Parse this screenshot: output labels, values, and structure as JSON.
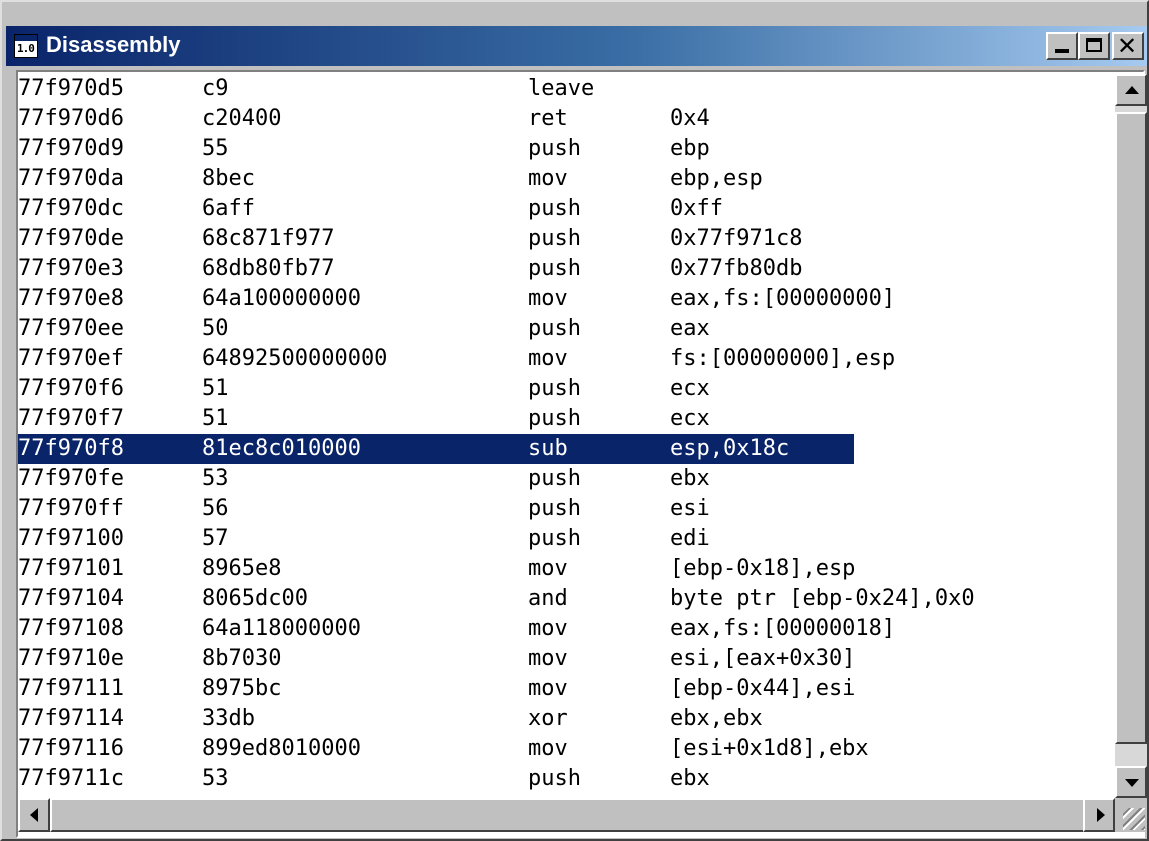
{
  "window": {
    "title": "Disassembly",
    "icon_label": "1.0",
    "controls": [
      "minimize",
      "maximize",
      "close"
    ],
    "close_glyph": "✕"
  },
  "colors": {
    "titlebar": "#0a246a",
    "selection_bg": "#0a246a",
    "selection_fg": "#ffffff"
  },
  "disassembly": {
    "selected_index": 12,
    "lines": [
      {
        "addr": "77f970d5",
        "bytes": "c9",
        "mnemonic": "leave",
        "operands": ""
      },
      {
        "addr": "77f970d6",
        "bytes": "c20400",
        "mnemonic": "ret",
        "operands": "0x4"
      },
      {
        "addr": "77f970d9",
        "bytes": "55",
        "mnemonic": "push",
        "operands": "ebp"
      },
      {
        "addr": "77f970da",
        "bytes": "8bec",
        "mnemonic": "mov",
        "operands": "ebp,esp"
      },
      {
        "addr": "77f970dc",
        "bytes": "6aff",
        "mnemonic": "push",
        "operands": "0xff"
      },
      {
        "addr": "77f970de",
        "bytes": "68c871f977",
        "mnemonic": "push",
        "operands": "0x77f971c8"
      },
      {
        "addr": "77f970e3",
        "bytes": "68db80fb77",
        "mnemonic": "push",
        "operands": "0x77fb80db"
      },
      {
        "addr": "77f970e8",
        "bytes": "64a100000000",
        "mnemonic": "mov",
        "operands": "eax,fs:[00000000]"
      },
      {
        "addr": "77f970ee",
        "bytes": "50",
        "mnemonic": "push",
        "operands": "eax"
      },
      {
        "addr": "77f970ef",
        "bytes": "64892500000000",
        "mnemonic": "mov",
        "operands": "fs:[00000000],esp"
      },
      {
        "addr": "77f970f6",
        "bytes": "51",
        "mnemonic": "push",
        "operands": "ecx"
      },
      {
        "addr": "77f970f7",
        "bytes": "51",
        "mnemonic": "push",
        "operands": "ecx"
      },
      {
        "addr": "77f970f8",
        "bytes": "81ec8c010000",
        "mnemonic": "sub",
        "operands": "esp,0x18c"
      },
      {
        "addr": "77f970fe",
        "bytes": "53",
        "mnemonic": "push",
        "operands": "ebx"
      },
      {
        "addr": "77f970ff",
        "bytes": "56",
        "mnemonic": "push",
        "operands": "esi"
      },
      {
        "addr": "77f97100",
        "bytes": "57",
        "mnemonic": "push",
        "operands": "edi"
      },
      {
        "addr": "77f97101",
        "bytes": "8965e8",
        "mnemonic": "mov",
        "operands": "[ebp-0x18],esp"
      },
      {
        "addr": "77f97104",
        "bytes": "8065dc00",
        "mnemonic": "and",
        "operands": "byte ptr [ebp-0x24],0x0"
      },
      {
        "addr": "77f97108",
        "bytes": "64a118000000",
        "mnemonic": "mov",
        "operands": "eax,fs:[00000018]"
      },
      {
        "addr": "77f9710e",
        "bytes": "8b7030",
        "mnemonic": "mov",
        "operands": "esi,[eax+0x30]"
      },
      {
        "addr": "77f97111",
        "bytes": "8975bc",
        "mnemonic": "mov",
        "operands": "[ebp-0x44],esi"
      },
      {
        "addr": "77f97114",
        "bytes": "33db",
        "mnemonic": "xor",
        "operands": "ebx,ebx"
      },
      {
        "addr": "77f97116",
        "bytes": "899ed8010000",
        "mnemonic": "mov",
        "operands": "[esi+0x1d8],ebx"
      },
      {
        "addr": "77f9711c",
        "bytes": "53",
        "mnemonic": "push",
        "operands": "ebx"
      }
    ]
  }
}
